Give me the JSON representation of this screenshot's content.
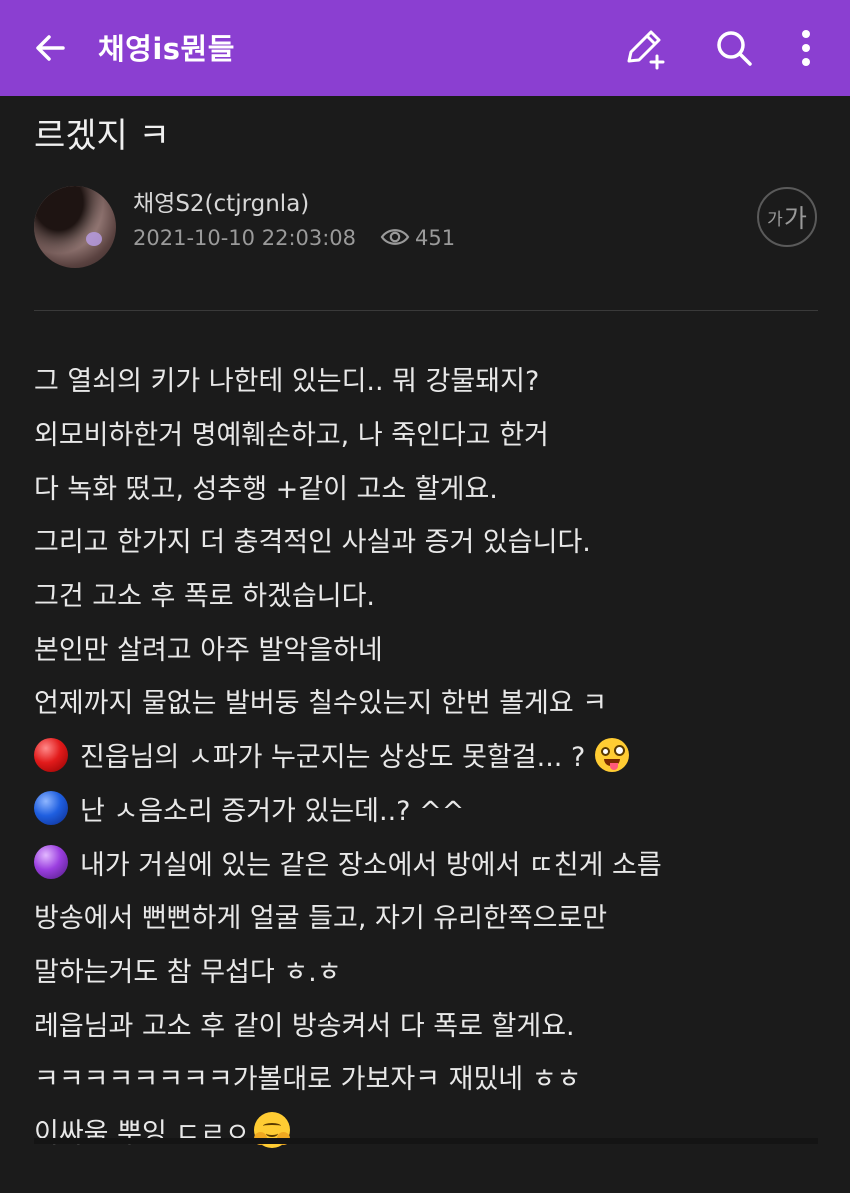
{
  "topbar": {
    "title": "채영is뭔들",
    "background_color": "#8b3fd1",
    "icons": [
      "arrow-left-icon",
      "pencil-plus-icon",
      "search-icon",
      "more-vertical-icon"
    ]
  },
  "post": {
    "title_tail": "르겠지 ㅋ",
    "author": "채영S2(ctjrgnla)",
    "datetime": "2021-10-10 22:03:08",
    "views": "451",
    "font_size_button": {
      "small": "가",
      "big": "가"
    },
    "lines": [
      {
        "text": "그 열쇠의 키가 나한테 있는디.. 뭐 강물돼지?"
      },
      {
        "text": "외모비하한거 명예훼손하고, 나 죽인다고 한거"
      },
      {
        "text": "다 녹화 떴고, 성추행 +같이 고소 할게요."
      },
      {
        "text": "그리고 한가지 더 충격적인 사실과 증거 있습니다."
      },
      {
        "text": "그건 고소 후 폭로 하겠습니다."
      },
      {
        "text": "본인만 살려고 아주 발악을하네"
      },
      {
        "text": "언제까지 물없는 발버둥 칠수있는지 한번 볼게요 ㅋ"
      },
      {
        "prefix_icon": "red-circle-icon",
        "text": "진읍님의 ㅅ파가 누군지는 상상도 못할걸... ? ",
        "suffix_icon": "zany-face-icon"
      },
      {
        "prefix_icon": "blue-circle-icon",
        "text": "난 ㅅ음소리 증거가 있는데..? ^^"
      },
      {
        "prefix_icon": "purple-circle-icon",
        "text": "내가 거실에 있는 같은 장소에서 방에서 ㄸ친게 소름"
      },
      {
        "text": "방송에서 뻔뻔하게 얼굴 들고, 자기 유리한쪽으로만"
      },
      {
        "text": "말하는거도 참 무섭다 ㅎ.ㅎ"
      },
      {
        "text": "레읍님과 고소 후 같이 방송켜서 다 폭로 할게요."
      },
      {
        "text": "ㅋㅋㅋㅋㅋㅋㅋㅋ가볼대로 가보자ㅋ 재밌네 ㅎㅎ"
      },
      {
        "text": "이싸움 뿌잉 ㄷㄹㅇ",
        "suffix_icon": "hugging-face-icon"
      }
    ]
  }
}
